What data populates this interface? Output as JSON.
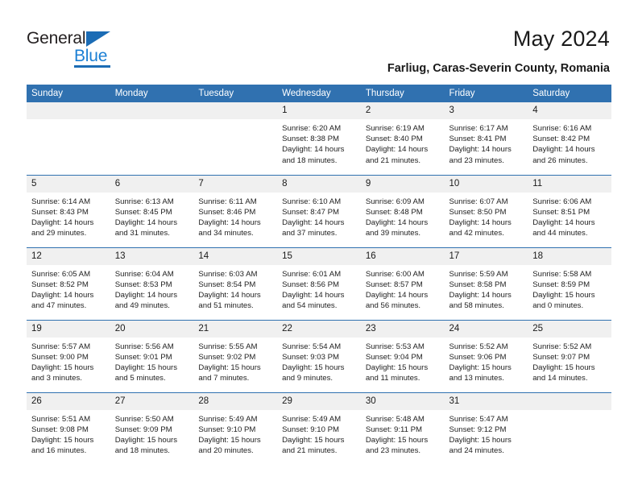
{
  "brand": {
    "name_part1": "General",
    "name_part2": "Blue",
    "triangle_color": "#1b6cb5",
    "blue_text_color": "#1b7fd4"
  },
  "header": {
    "title": "May 2024",
    "subtitle": "Farliug, Caras-Severin County, Romania",
    "header_bg": "#3071b0",
    "header_text_color": "#ffffff",
    "daynum_bg": "#f0f0f0"
  },
  "weekday_headers": [
    "Sunday",
    "Monday",
    "Tuesday",
    "Wednesday",
    "Thursday",
    "Friday",
    "Saturday"
  ],
  "labels": {
    "sunrise": "Sunrise:",
    "sunset": "Sunset:",
    "daylight": "Daylight:"
  },
  "weeks": [
    [
      {
        "day": "",
        "sunrise": "",
        "sunset": "",
        "daylight_line1": "",
        "daylight_line2": ""
      },
      {
        "day": "",
        "sunrise": "",
        "sunset": "",
        "daylight_line1": "",
        "daylight_line2": ""
      },
      {
        "day": "",
        "sunrise": "",
        "sunset": "",
        "daylight_line1": "",
        "daylight_line2": ""
      },
      {
        "day": "1",
        "sunrise": "Sunrise: 6:20 AM",
        "sunset": "Sunset: 8:38 PM",
        "daylight_line1": "Daylight: 14 hours",
        "daylight_line2": "and 18 minutes."
      },
      {
        "day": "2",
        "sunrise": "Sunrise: 6:19 AM",
        "sunset": "Sunset: 8:40 PM",
        "daylight_line1": "Daylight: 14 hours",
        "daylight_line2": "and 21 minutes."
      },
      {
        "day": "3",
        "sunrise": "Sunrise: 6:17 AM",
        "sunset": "Sunset: 8:41 PM",
        "daylight_line1": "Daylight: 14 hours",
        "daylight_line2": "and 23 minutes."
      },
      {
        "day": "4",
        "sunrise": "Sunrise: 6:16 AM",
        "sunset": "Sunset: 8:42 PM",
        "daylight_line1": "Daylight: 14 hours",
        "daylight_line2": "and 26 minutes."
      }
    ],
    [
      {
        "day": "5",
        "sunrise": "Sunrise: 6:14 AM",
        "sunset": "Sunset: 8:43 PM",
        "daylight_line1": "Daylight: 14 hours",
        "daylight_line2": "and 29 minutes."
      },
      {
        "day": "6",
        "sunrise": "Sunrise: 6:13 AM",
        "sunset": "Sunset: 8:45 PM",
        "daylight_line1": "Daylight: 14 hours",
        "daylight_line2": "and 31 minutes."
      },
      {
        "day": "7",
        "sunrise": "Sunrise: 6:11 AM",
        "sunset": "Sunset: 8:46 PM",
        "daylight_line1": "Daylight: 14 hours",
        "daylight_line2": "and 34 minutes."
      },
      {
        "day": "8",
        "sunrise": "Sunrise: 6:10 AM",
        "sunset": "Sunset: 8:47 PM",
        "daylight_line1": "Daylight: 14 hours",
        "daylight_line2": "and 37 minutes."
      },
      {
        "day": "9",
        "sunrise": "Sunrise: 6:09 AM",
        "sunset": "Sunset: 8:48 PM",
        "daylight_line1": "Daylight: 14 hours",
        "daylight_line2": "and 39 minutes."
      },
      {
        "day": "10",
        "sunrise": "Sunrise: 6:07 AM",
        "sunset": "Sunset: 8:50 PM",
        "daylight_line1": "Daylight: 14 hours",
        "daylight_line2": "and 42 minutes."
      },
      {
        "day": "11",
        "sunrise": "Sunrise: 6:06 AM",
        "sunset": "Sunset: 8:51 PM",
        "daylight_line1": "Daylight: 14 hours",
        "daylight_line2": "and 44 minutes."
      }
    ],
    [
      {
        "day": "12",
        "sunrise": "Sunrise: 6:05 AM",
        "sunset": "Sunset: 8:52 PM",
        "daylight_line1": "Daylight: 14 hours",
        "daylight_line2": "and 47 minutes."
      },
      {
        "day": "13",
        "sunrise": "Sunrise: 6:04 AM",
        "sunset": "Sunset: 8:53 PM",
        "daylight_line1": "Daylight: 14 hours",
        "daylight_line2": "and 49 minutes."
      },
      {
        "day": "14",
        "sunrise": "Sunrise: 6:03 AM",
        "sunset": "Sunset: 8:54 PM",
        "daylight_line1": "Daylight: 14 hours",
        "daylight_line2": "and 51 minutes."
      },
      {
        "day": "15",
        "sunrise": "Sunrise: 6:01 AM",
        "sunset": "Sunset: 8:56 PM",
        "daylight_line1": "Daylight: 14 hours",
        "daylight_line2": "and 54 minutes."
      },
      {
        "day": "16",
        "sunrise": "Sunrise: 6:00 AM",
        "sunset": "Sunset: 8:57 PM",
        "daylight_line1": "Daylight: 14 hours",
        "daylight_line2": "and 56 minutes."
      },
      {
        "day": "17",
        "sunrise": "Sunrise: 5:59 AM",
        "sunset": "Sunset: 8:58 PM",
        "daylight_line1": "Daylight: 14 hours",
        "daylight_line2": "and 58 minutes."
      },
      {
        "day": "18",
        "sunrise": "Sunrise: 5:58 AM",
        "sunset": "Sunset: 8:59 PM",
        "daylight_line1": "Daylight: 15 hours",
        "daylight_line2": "and 0 minutes."
      }
    ],
    [
      {
        "day": "19",
        "sunrise": "Sunrise: 5:57 AM",
        "sunset": "Sunset: 9:00 PM",
        "daylight_line1": "Daylight: 15 hours",
        "daylight_line2": "and 3 minutes."
      },
      {
        "day": "20",
        "sunrise": "Sunrise: 5:56 AM",
        "sunset": "Sunset: 9:01 PM",
        "daylight_line1": "Daylight: 15 hours",
        "daylight_line2": "and 5 minutes."
      },
      {
        "day": "21",
        "sunrise": "Sunrise: 5:55 AM",
        "sunset": "Sunset: 9:02 PM",
        "daylight_line1": "Daylight: 15 hours",
        "daylight_line2": "and 7 minutes."
      },
      {
        "day": "22",
        "sunrise": "Sunrise: 5:54 AM",
        "sunset": "Sunset: 9:03 PM",
        "daylight_line1": "Daylight: 15 hours",
        "daylight_line2": "and 9 minutes."
      },
      {
        "day": "23",
        "sunrise": "Sunrise: 5:53 AM",
        "sunset": "Sunset: 9:04 PM",
        "daylight_line1": "Daylight: 15 hours",
        "daylight_line2": "and 11 minutes."
      },
      {
        "day": "24",
        "sunrise": "Sunrise: 5:52 AM",
        "sunset": "Sunset: 9:06 PM",
        "daylight_line1": "Daylight: 15 hours",
        "daylight_line2": "and 13 minutes."
      },
      {
        "day": "25",
        "sunrise": "Sunrise: 5:52 AM",
        "sunset": "Sunset: 9:07 PM",
        "daylight_line1": "Daylight: 15 hours",
        "daylight_line2": "and 14 minutes."
      }
    ],
    [
      {
        "day": "26",
        "sunrise": "Sunrise: 5:51 AM",
        "sunset": "Sunset: 9:08 PM",
        "daylight_line1": "Daylight: 15 hours",
        "daylight_line2": "and 16 minutes."
      },
      {
        "day": "27",
        "sunrise": "Sunrise: 5:50 AM",
        "sunset": "Sunset: 9:09 PM",
        "daylight_line1": "Daylight: 15 hours",
        "daylight_line2": "and 18 minutes."
      },
      {
        "day": "28",
        "sunrise": "Sunrise: 5:49 AM",
        "sunset": "Sunset: 9:10 PM",
        "daylight_line1": "Daylight: 15 hours",
        "daylight_line2": "and 20 minutes."
      },
      {
        "day": "29",
        "sunrise": "Sunrise: 5:49 AM",
        "sunset": "Sunset: 9:10 PM",
        "daylight_line1": "Daylight: 15 hours",
        "daylight_line2": "and 21 minutes."
      },
      {
        "day": "30",
        "sunrise": "Sunrise: 5:48 AM",
        "sunset": "Sunset: 9:11 PM",
        "daylight_line1": "Daylight: 15 hours",
        "daylight_line2": "and 23 minutes."
      },
      {
        "day": "31",
        "sunrise": "Sunrise: 5:47 AM",
        "sunset": "Sunset: 9:12 PM",
        "daylight_line1": "Daylight: 15 hours",
        "daylight_line2": "and 24 minutes."
      },
      {
        "day": "",
        "sunrise": "",
        "sunset": "",
        "daylight_line1": "",
        "daylight_line2": ""
      }
    ]
  ]
}
